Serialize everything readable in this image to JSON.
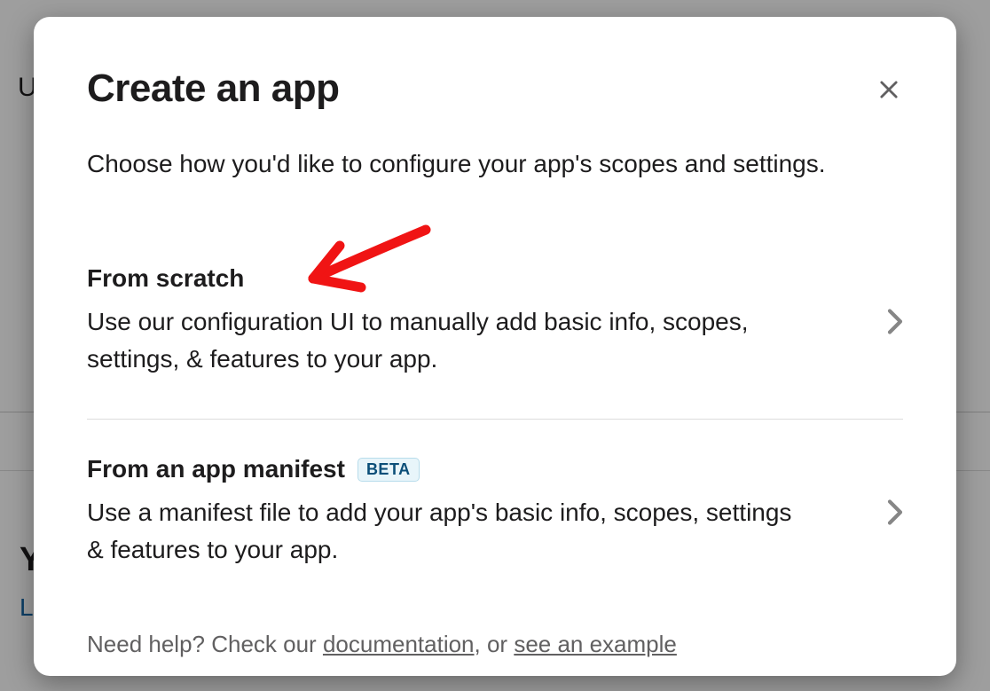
{
  "background": {
    "u": "U",
    "y": "Y",
    "le": "Le"
  },
  "modal": {
    "title": "Create an app",
    "subtitle": "Choose how you'd like to configure your app's scopes and settings.",
    "options": [
      {
        "title": "From scratch",
        "desc": "Use our configuration UI to manually add basic info, scopes, settings, & features to your app.",
        "badge": null
      },
      {
        "title": "From an app manifest",
        "desc": "Use a manifest file to add your app's basic info, scopes, settings & features to your app.",
        "badge": "BETA"
      }
    ],
    "help": {
      "prefix": "Need help? Check our ",
      "link1": "documentation",
      "mid": ", or ",
      "link2": "see an example"
    }
  }
}
